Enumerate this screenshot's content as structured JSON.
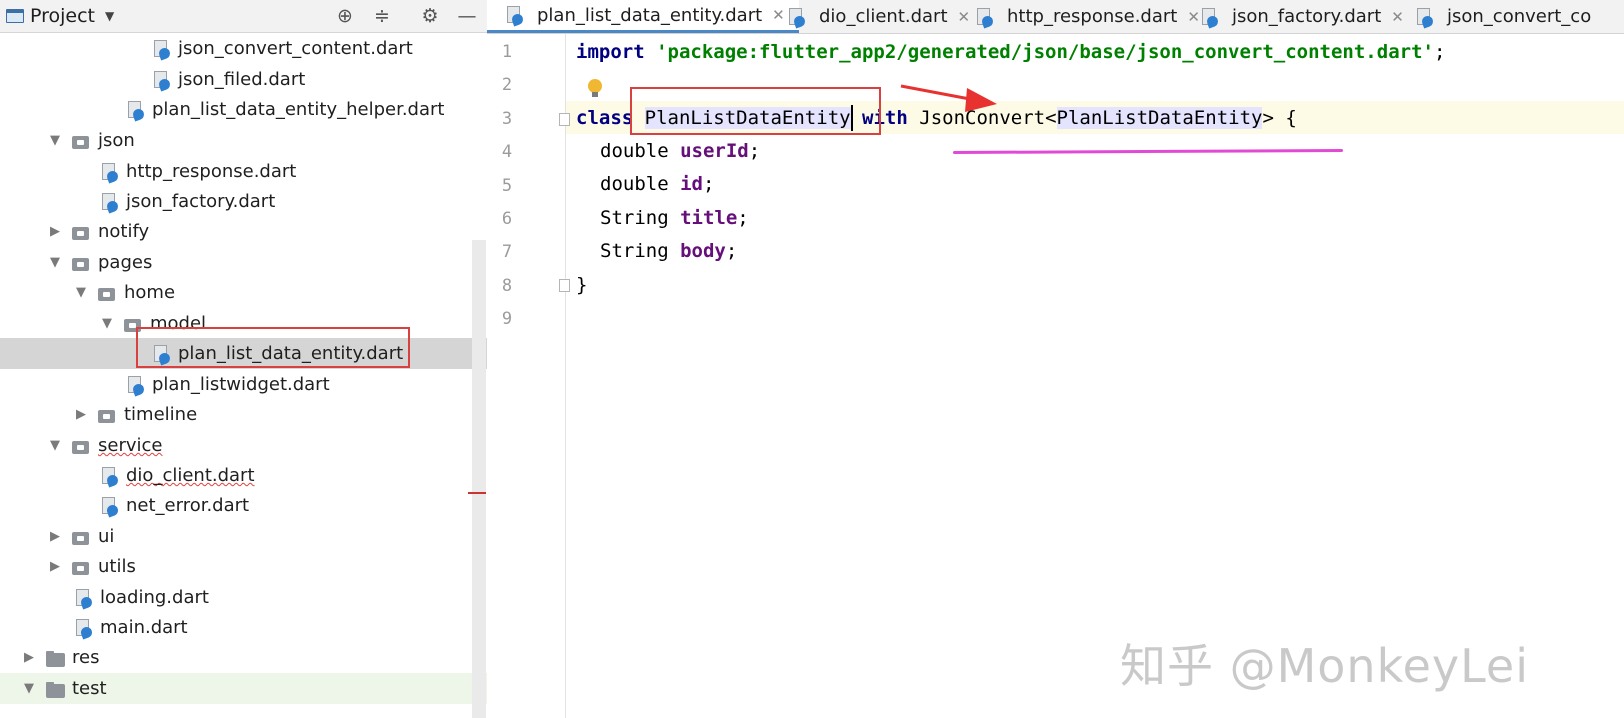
{
  "panel": {
    "title": "Project",
    "tools": [
      "crosshair-icon",
      "collapse-icon",
      "gear-icon",
      "minimize-icon"
    ]
  },
  "tree": [
    {
      "label": "json_convert_content.dart",
      "type": "dart",
      "depth": 5
    },
    {
      "label": "json_filed.dart",
      "type": "dart",
      "depth": 5
    },
    {
      "label": "plan_list_data_entity_helper.dart",
      "type": "dart",
      "depth": 4
    },
    {
      "label": "json",
      "type": "folder",
      "depth": 1,
      "expanded": true
    },
    {
      "label": "http_response.dart",
      "type": "dart",
      "depth": 3
    },
    {
      "label": "json_factory.dart",
      "type": "dart",
      "depth": 3
    },
    {
      "label": "notify",
      "type": "folder",
      "depth": 1,
      "expanded": false
    },
    {
      "label": "pages",
      "type": "folder",
      "depth": 1,
      "expanded": true
    },
    {
      "label": "home",
      "type": "folder",
      "depth": 2,
      "expanded": true
    },
    {
      "label": "model",
      "type": "folder",
      "depth": 3,
      "expanded": true
    },
    {
      "label": "plan_list_data_entity.dart",
      "type": "dart",
      "depth": 5,
      "selected": true
    },
    {
      "label": "plan_listwidget.dart",
      "type": "dart",
      "depth": 4
    },
    {
      "label": "timeline",
      "type": "folder",
      "depth": 2,
      "expanded": false
    },
    {
      "label": "service",
      "type": "folder",
      "depth": 1,
      "expanded": true,
      "squiggle": true
    },
    {
      "label": "dio_client.dart",
      "type": "dart",
      "depth": 3,
      "squiggle": true
    },
    {
      "label": "net_error.dart",
      "type": "dart",
      "depth": 3
    },
    {
      "label": "ui",
      "type": "folder",
      "depth": 1,
      "expanded": false
    },
    {
      "label": "utils",
      "type": "folder",
      "depth": 1,
      "expanded": false
    },
    {
      "label": "loading.dart",
      "type": "dart",
      "depth": 2
    },
    {
      "label": "main.dart",
      "type": "dart",
      "depth": 2
    },
    {
      "label": "res",
      "type": "folder-plain",
      "depth": 0,
      "expanded": false
    },
    {
      "label": "test",
      "type": "folder-plain",
      "depth": 0,
      "expanded": true
    }
  ],
  "tabs": [
    {
      "label": "plan_list_data_entity.dart",
      "active": true,
      "closable": true
    },
    {
      "label": "dio_client.dart",
      "closable": true
    },
    {
      "label": "http_response.dart",
      "closable": true
    },
    {
      "label": "json_factory.dart",
      "closable": true
    },
    {
      "label": "json_convert_co",
      "closable": false
    }
  ],
  "editor": {
    "line_numbers": [
      "1",
      "2",
      "3",
      "4",
      "5",
      "6",
      "7",
      "8",
      "9"
    ],
    "line1": {
      "kw": "import",
      "str": "'package:flutter_app2/generated/json/base/json_convert_content.dart'",
      "end": ";"
    },
    "line3": {
      "kw_class": "class",
      "class_name_a": "PlanListDataEnti",
      "class_name_b": "ty",
      "kw_with": "with",
      "mixin": "JsonConvert",
      "lt": "<",
      "generic": "PlanListDataEntity",
      "gt": ">",
      "brace": " {"
    },
    "fields": [
      {
        "type": "double",
        "name": "userId"
      },
      {
        "type": "double",
        "name": "id"
      },
      {
        "type": "String",
        "name": "title"
      },
      {
        "type": "String",
        "name": "body"
      }
    ],
    "close_brace": "}"
  },
  "watermark": "知乎 @MonkeyLei",
  "colors": {
    "annotation_red": "#d94040",
    "underline_magenta": "#e24ad6",
    "keyword": "#000080",
    "string": "#008000",
    "field": "#660e7a"
  }
}
